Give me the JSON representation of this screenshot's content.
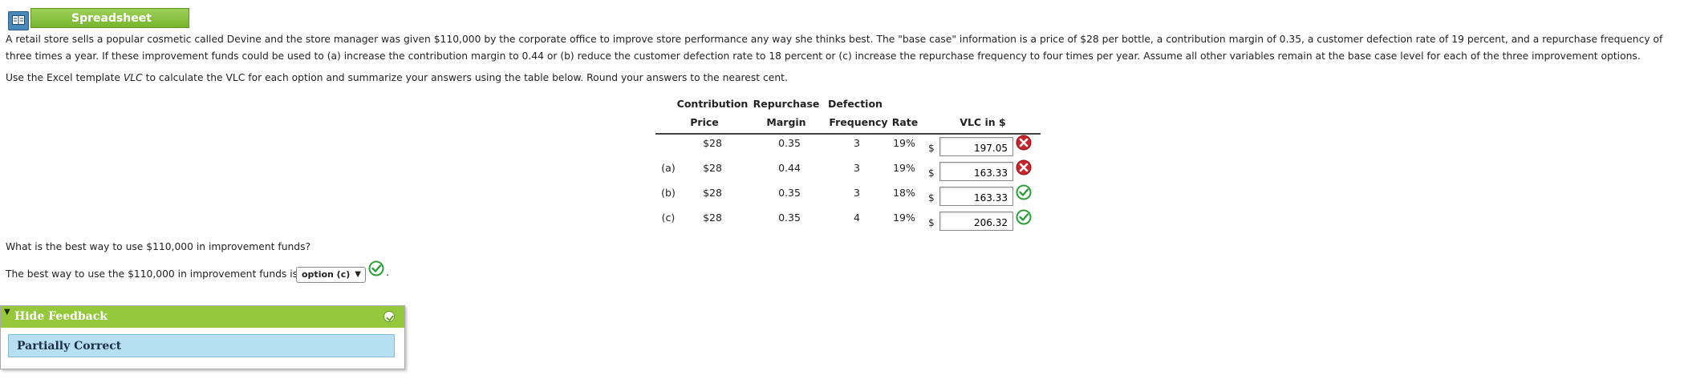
{
  "header": {
    "spreadsheet_label": "Spreadsheet"
  },
  "problem": {
    "paragraph": "A retail store sells a popular cosmetic called Devine and the store manager was given $110,000 by the corporate office to improve store performance any way she thinks best. The \"base case\" information is a price of $28 per bottle, a contribution margin of 0.35, a customer defection rate of 19 percent, and a repurchase frequency of three times a year. If these improvement funds could be used to (a) increase the contribution margin to 0.44 or (b) reduce the customer defection rate to 18 percent or (c) increase the repurchase frequency to four times per year. Assume all other variables remain at the base case level for each of the three improvement options.",
    "instruction_pre": "Use the Excel template ",
    "instruction_em": "VLC",
    "instruction_post": " to calculate the VLC for each option and summarize your answers using the table below. Round your answers to the nearest cent."
  },
  "table": {
    "header_top": [
      "Contribution",
      "Repurchase",
      "Defection"
    ],
    "header_bottom": [
      "Price",
      "Margin",
      "Frequency",
      "Rate",
      "VLC in $"
    ],
    "currency_symbol": "$",
    "rows": [
      {
        "label": "",
        "price": "$28",
        "margin": "0.35",
        "frequency": "3",
        "rate": "19%",
        "vlc": "197.05",
        "status": "incorrect"
      },
      {
        "label": "(a)",
        "price": "$28",
        "margin": "0.44",
        "frequency": "3",
        "rate": "19%",
        "vlc": "163.33",
        "status": "incorrect"
      },
      {
        "label": "(b)",
        "price": "$28",
        "margin": "0.35",
        "frequency": "3",
        "rate": "18%",
        "vlc": "163.33",
        "status": "correct"
      },
      {
        "label": "(c)",
        "price": "$28",
        "margin": "0.35",
        "frequency": "4",
        "rate": "19%",
        "vlc": "206.32",
        "status": "correct"
      }
    ]
  },
  "question": {
    "prompt": "What is the best way to use $110,000 in improvement funds?",
    "answer_pre": "The best way to use the $110,000 in improvement funds is",
    "selected_option": "option (c)",
    "answer_post": ".",
    "status": "correct"
  },
  "feedback": {
    "title": "Hide Feedback",
    "result": "Partially Correct"
  },
  "colors": {
    "correct": "#2e9e3a",
    "incorrect": "#c9252c",
    "green_bar": "#95c83b",
    "feedback_body": "#b6dff1"
  }
}
